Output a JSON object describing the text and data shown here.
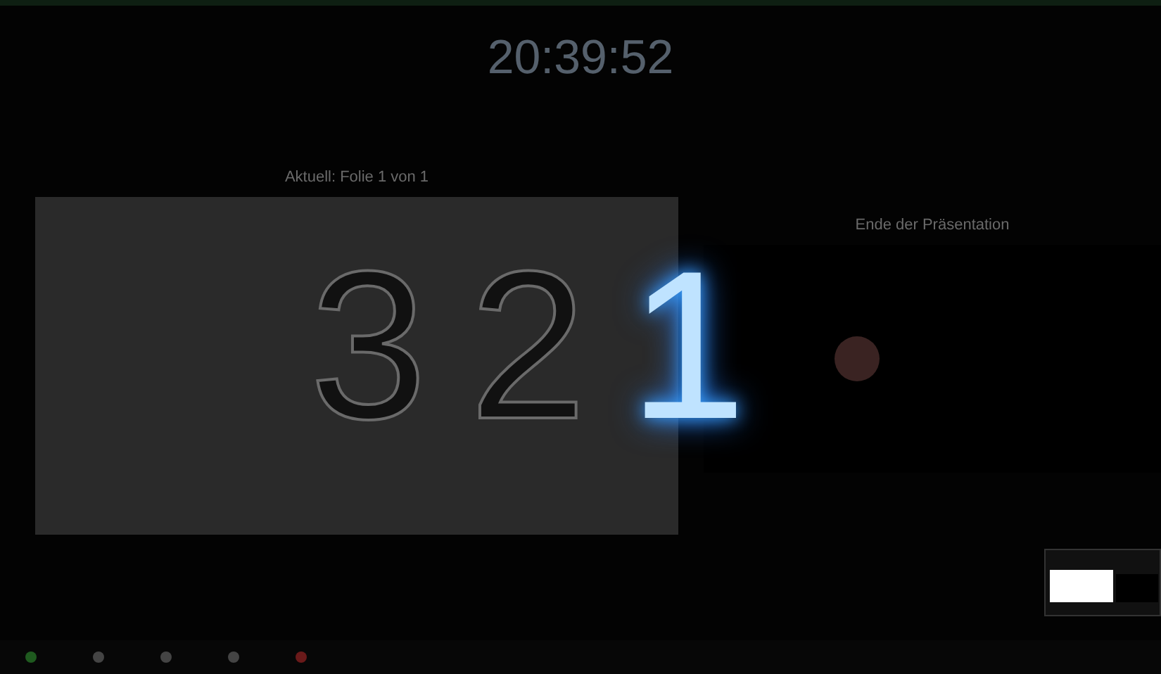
{
  "clock": "20:39:52",
  "current_slide": {
    "label": "Aktuell: Folie 1 von 1"
  },
  "next_slide": {
    "label": "Ende der Präsentation"
  },
  "countdown": [
    {
      "digit": "3",
      "selected": false
    },
    {
      "digit": "2",
      "selected": false
    },
    {
      "digit": "1",
      "selected": true
    }
  ]
}
